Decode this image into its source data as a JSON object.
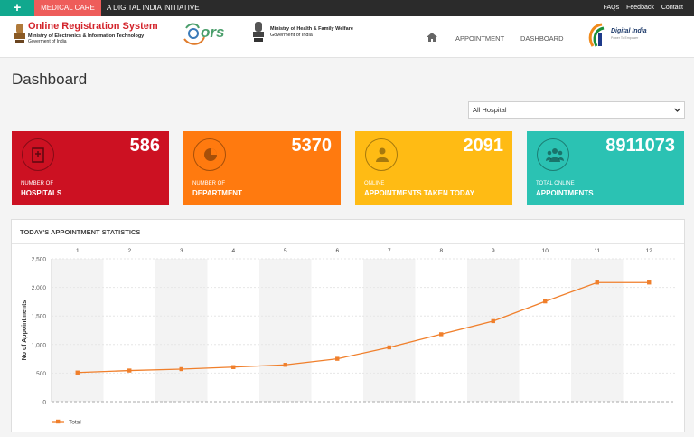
{
  "topbar": {
    "plus": "+",
    "medical_care": "MEDICAL CARE",
    "initiative": "A DIGITAL INDIA INITIATIVE",
    "links": [
      "FAQs",
      "Feedback",
      "Contact"
    ]
  },
  "header": {
    "ors_title": "Online Registration System",
    "ors_sub1": "Ministry of Electronics & Information Technology",
    "ors_sub2": "Goverment of India",
    "ors_logo_text": "ors",
    "mohfw_line1": "Ministry of Health & Family Welfare",
    "mohfw_line2": "Goverment of India",
    "nav": {
      "appointment": "APPOINTMENT",
      "dashboard": "DASHBOARD"
    },
    "digital_india": "Digital India",
    "digital_india_sub": "Power To Empower"
  },
  "page": {
    "title": "Dashboard"
  },
  "filter": {
    "selected": "All Hospital"
  },
  "cards": [
    {
      "value": "586",
      "label1": "NUMBER OF",
      "label2": "HOSPITALS",
      "color": "#cc1122",
      "icon": "hospital-icon"
    },
    {
      "value": "5370",
      "label1": "NUMBER OF",
      "label2": "DEPARTMENT",
      "color": "#ff7a0f",
      "icon": "pie-chart-icon"
    },
    {
      "value": "2091",
      "label1": "ONLINE",
      "label2": "APPOINTMENTS TAKEN TODAY",
      "color": "#ffbb14",
      "icon": "doctor-icon"
    },
    {
      "value": "8911073",
      "label1": "TOTAL ONLINE",
      "label2": "APPOINTMENTS",
      "color": "#2bc2b3",
      "icon": "users-icon"
    }
  ],
  "panel": {
    "title": "TODAY'S APPOINTMENT STATISTICS"
  },
  "chart_data": {
    "type": "line",
    "x": [
      1,
      2,
      3,
      4,
      5,
      6,
      7,
      8,
      9,
      10,
      11,
      12
    ],
    "y_ticks": [
      "0",
      "500",
      "1,000",
      "1,500",
      "2,000",
      "2,500"
    ],
    "ylabel": "No of Appointments",
    "ylim": [
      0,
      2500
    ],
    "x_axis_position": "top",
    "grid": true,
    "series": [
      {
        "name": "Total",
        "color": "#f07f2b",
        "values": [
          510,
          545,
          570,
          605,
          645,
          750,
          950,
          1180,
          1410,
          1755,
          2085,
          2085
        ]
      }
    ],
    "legend": "bottom-left"
  }
}
